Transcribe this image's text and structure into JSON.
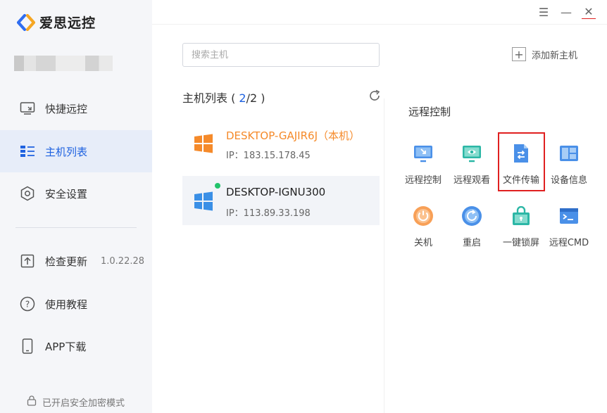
{
  "app": {
    "name": "爱思远控"
  },
  "window_controls": {
    "menu": "☰",
    "minimize": "—",
    "close": "✕"
  },
  "sidebar": {
    "items": [
      {
        "label": "快捷远控",
        "icon": "monitor-icon"
      },
      {
        "label": "主机列表",
        "icon": "host-list-icon",
        "active": true
      },
      {
        "label": "安全设置",
        "icon": "shield-icon"
      },
      {
        "label": "检查更新",
        "icon": "upload-icon",
        "version": "1.0.22.28"
      },
      {
        "label": "使用教程",
        "icon": "help-icon"
      },
      {
        "label": "APP下载",
        "icon": "phone-icon"
      }
    ],
    "footer": "已开启安全加密模式"
  },
  "search": {
    "placeholder": "搜索主机"
  },
  "add_host": {
    "label": "添加新主机"
  },
  "host_list": {
    "title_prefix": "主机列表 ( ",
    "count_current": "2",
    "count_sep": "/2 )",
    "hosts": [
      {
        "name": "DESKTOP-GAJIR6J（本机）",
        "ip": "IP：183.15.178.45",
        "color": "#f58a2a"
      },
      {
        "name": "DESKTOP-IGNU300",
        "ip": "IP：113.89.33.198",
        "color": "#3a8fe6",
        "online": true
      }
    ]
  },
  "panel": {
    "title": "远程控制",
    "tools": [
      {
        "label": "远程控制",
        "icon": "remote-control-icon"
      },
      {
        "label": "远程观看",
        "icon": "remote-view-icon"
      },
      {
        "label": "文件传输",
        "icon": "file-transfer-icon",
        "highlighted": true
      },
      {
        "label": "设备信息",
        "icon": "device-info-icon"
      },
      {
        "label": "关机",
        "icon": "power-icon"
      },
      {
        "label": "重启",
        "icon": "restart-icon"
      },
      {
        "label": "一键锁屏",
        "icon": "lock-screen-icon"
      },
      {
        "label": "远程CMD",
        "icon": "cmd-icon"
      }
    ]
  },
  "colors": {
    "accent": "#1f62e0",
    "local_host": "#f58a2a",
    "online": "#22c36b",
    "highlight": "#e02020"
  }
}
